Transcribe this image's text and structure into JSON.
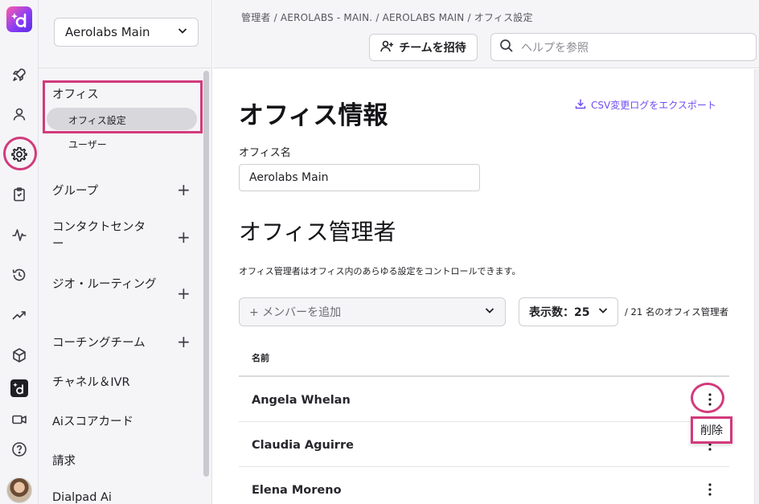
{
  "sidebar": {
    "office_select": "Aerolabs Main",
    "office": {
      "label": "オフィス",
      "sub_items": [
        {
          "label": "オフィス設定",
          "active": true
        },
        {
          "label": "ユーザー",
          "active": false
        }
      ]
    },
    "items": [
      {
        "label": "グループ",
        "plus": true
      },
      {
        "label": "コンタクトセンター",
        "plus": true
      },
      {
        "label": "ジオ・ルーティング",
        "plus": true
      },
      {
        "label": "コーチングチーム",
        "plus": true
      },
      {
        "label": "チャネル＆IVR",
        "plus": false
      },
      {
        "label": "Aiスコアカード",
        "plus": false
      },
      {
        "label": "請求",
        "plus": false
      },
      {
        "label": "Dialpad Ai",
        "plus": false
      }
    ]
  },
  "rail": {
    "icons": [
      "logo-icon",
      "rocket-icon",
      "user-icon",
      "gear-icon",
      "clipboard-icon",
      "activity-icon",
      "history-icon",
      "trend-icon",
      "cube-icon",
      "dialpad-icon",
      "video-icon",
      "help-icon"
    ],
    "active": "gear-icon"
  },
  "header": {
    "breadcrumb": "管理者 / AEROLABS - MAIN. / AEROLABS MAIN / オフィス設定",
    "invite_label": "チームを招待",
    "search_placeholder": "ヘルプを参照"
  },
  "main": {
    "title": "オフィス情報",
    "export_label": "CSV変更ログをエクスポート",
    "office_name_label": "オフィス名",
    "office_name_value": "Aerolabs Main",
    "admins_title": "オフィス管理者",
    "admins_desc": "オフィス管理者はオフィス内のあらゆる設定をコントロールできます。",
    "add_member_placeholder": "+ メンバーを追加",
    "page_size_label": "表示数：25",
    "member_count_label": "/ 21 名のオフィス管理者",
    "column_name": "名前",
    "rows": [
      {
        "name": "Angela Whelan"
      },
      {
        "name": "Claudia Aguirre"
      },
      {
        "name": "Elena Moreno"
      }
    ],
    "row_menu_popup": "削除"
  },
  "colors": {
    "highlight": "#d23a7c",
    "accent": "#6f4cf0",
    "sidebar_bg": "#f5f5f7"
  }
}
